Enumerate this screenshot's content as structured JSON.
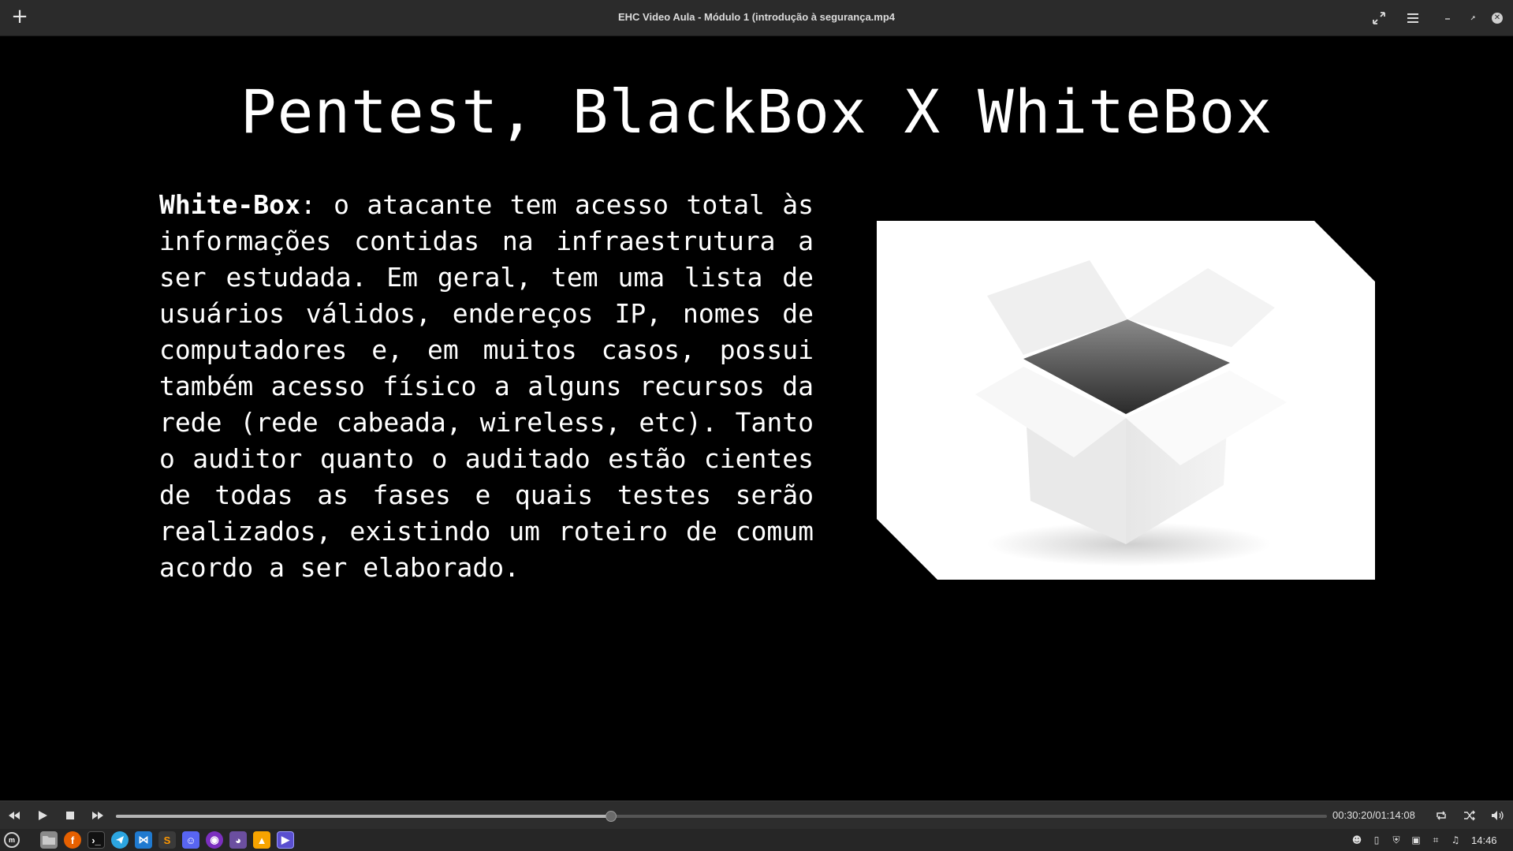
{
  "window": {
    "title": "EHC Video Aula - Módulo 1 (introdução à segurança.mp4",
    "add_icon": "plus-icon",
    "fullscreen_icon": "expand-icon",
    "menu_icon": "hamburger-icon",
    "minimize_icon": "minimize-icon",
    "restore_icon": "restore-icon",
    "close_icon": "close-icon"
  },
  "slide": {
    "title": "Pentest, BlackBox X WhiteBox",
    "term": "White-Box",
    "body": ": o atacante tem acesso total às informações contidas na infraestrutura a ser estudada. Em geral, tem uma lista de usuários válidos, endereços IP, nomes de computadores e, em muitos casos, possui também acesso físico a alguns recursos da rede (rede cabeada, wireless, etc). Tanto o auditor quanto o auditado estão cientes de todas as fases e quais testes serão realizados, existindo um roteiro de comum acordo a ser elaborado.",
    "image": "open-white-box-picture"
  },
  "player": {
    "time": "00:30:20/01:14:08",
    "progress": 0.409,
    "buttons": [
      "rewind-icon",
      "play-icon",
      "stop-icon",
      "fast-forward-icon",
      "repeat-icon",
      "shuffle-icon",
      "volume-icon"
    ]
  },
  "taskbar": {
    "clock": "14:46",
    "apps": [
      "menu",
      "files",
      "firefox",
      "terminal",
      "telegram",
      "vscode",
      "sublime",
      "discord",
      "podcast",
      "hexchat",
      "vlc",
      "video-player"
    ],
    "colors": {
      "firefox": "#e66000",
      "telegram": "#2ca5e0",
      "vscode": "#1f7ad0",
      "sublime": "#ff9800",
      "discord": "#5865f2",
      "podcast": "#7b2fbf",
      "vlc": "#f7a400",
      "player": "#5a4fcf"
    }
  }
}
